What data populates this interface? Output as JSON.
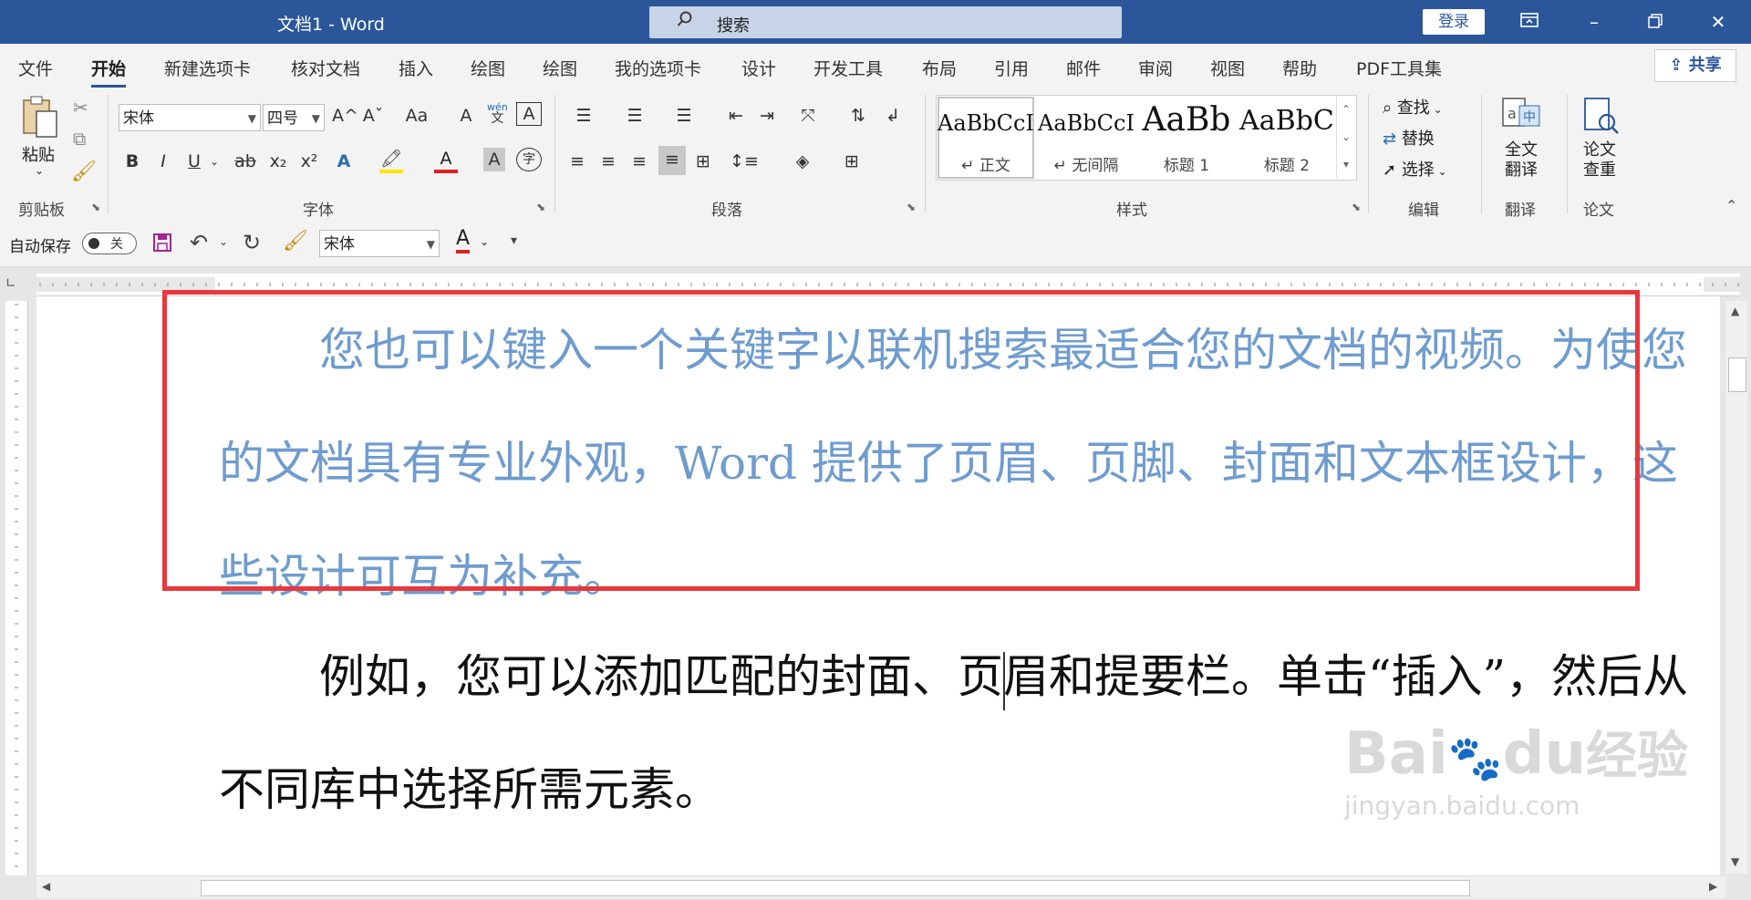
{
  "window": {
    "title": "文档1 - Word",
    "search_placeholder": "搜索",
    "login_label": "登录"
  },
  "tabs": [
    {
      "label": "文件"
    },
    {
      "label": "开始",
      "active": true
    },
    {
      "label": "新建选项卡"
    },
    {
      "label": "核对文档"
    },
    {
      "label": "插入"
    },
    {
      "label": "绘图"
    },
    {
      "label": "绘图"
    },
    {
      "label": "我的选项卡"
    },
    {
      "label": "设计"
    },
    {
      "label": "开发工具"
    },
    {
      "label": "布局"
    },
    {
      "label": "引用"
    },
    {
      "label": "邮件"
    },
    {
      "label": "审阅"
    },
    {
      "label": "视图"
    },
    {
      "label": "帮助"
    },
    {
      "label": "PDF工具集"
    }
  ],
  "share_label": "共享",
  "ribbon": {
    "clipboard": {
      "paste_label": "粘贴",
      "group_label": "剪贴板"
    },
    "font": {
      "font_name": "宋体",
      "font_size": "四号",
      "group_label": "字体",
      "grow": "A^",
      "shrink": "Aˇ",
      "case": "Aa",
      "bold": "B",
      "italic": "I",
      "underline": "U",
      "strike": "ab",
      "sub": "x₂",
      "sup": "x²",
      "phonetic_top": "wén",
      "phonetic_bottom": "文",
      "char_shade": "A",
      "enclose": "字"
    },
    "paragraph": {
      "group_label": "段落"
    },
    "styles": {
      "group_label": "样式",
      "items": [
        {
          "preview": "AaBbCcI",
          "name": "↵ 正文",
          "selected": true
        },
        {
          "preview": "AaBbCcI",
          "name": "↵ 无间隔"
        },
        {
          "preview": "AaBb",
          "name": "标题 1"
        },
        {
          "preview": "AaBbC",
          "name": "标题 2"
        }
      ]
    },
    "editing": {
      "group_label": "编辑",
      "find": "查找",
      "replace": "替换",
      "select": "选择"
    },
    "translate": {
      "group_label": "翻译",
      "button": "全文\n翻译"
    },
    "paper": {
      "group_label": "论文",
      "button": "论文\n查重"
    }
  },
  "qat": {
    "autosave_label": "自动保存",
    "autosave_state": "关",
    "font_name": "宋体",
    "font_color_letter": "A"
  },
  "document": {
    "para1": "您也可以键入一个关键字以联机搜索最适合您的文档的视频。为使您的文档具有专业外观，Word 提供了页眉、页脚、封面和文本框设计，这些设计可互为补充。",
    "para2": "例如，您可以添加匹配的封面、页眉和提要栏。单击“插入”，然后从不同库中选择所需元素。"
  },
  "watermark": {
    "line1": "Bai",
    "paw": "du",
    "line1b": "经验",
    "line2": "jingyan.baidu.com"
  },
  "colors": {
    "title_bar": "#2b579a",
    "highlight_box": "#e8383d",
    "para1_text": "#6f9ccf"
  }
}
